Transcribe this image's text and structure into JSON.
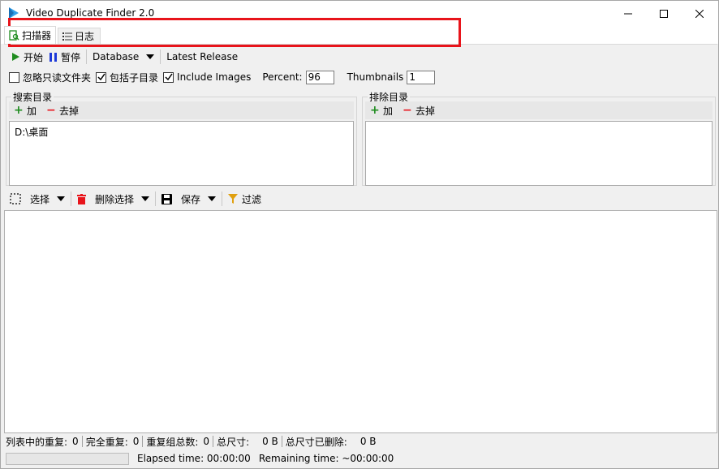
{
  "window": {
    "title": "Video Duplicate Finder 2.0"
  },
  "tabs": [
    {
      "label": "扫描器",
      "icon": "scanner-icon",
      "active": true
    },
    {
      "label": "日志",
      "icon": "list-icon",
      "active": false
    }
  ],
  "toolbar": {
    "start_label": "开始",
    "pause_label": "暂停",
    "database_label": "Database",
    "latest_release_label": "Latest Release"
  },
  "options": {
    "ignore_readonly_label": "忽略只读文件夹",
    "ignore_readonly_checked": false,
    "include_subdirs_label": "包括子目录",
    "include_subdirs_checked": true,
    "include_images_label": "Include Images",
    "include_images_checked": true,
    "percent_label": "Percent:",
    "percent_value": "96",
    "thumbnails_label": "Thumbnails",
    "thumbnails_value": "1"
  },
  "search_dirs": {
    "title": "搜索目录",
    "add_label": "加",
    "remove_label": "去掉",
    "items": [
      "D:\\桌面"
    ]
  },
  "exclude_dirs": {
    "title": "排除目录",
    "add_label": "加",
    "remove_label": "去掉",
    "items": []
  },
  "results_toolbar": {
    "select_label": "选择",
    "delete_selection_label": "删除选择",
    "save_label": "保存",
    "filter_label": "过滤"
  },
  "statusbar": {
    "dupes_in_list_label": "列表中的重复:",
    "dupes_in_list_value": "0",
    "full_dupes_label": "完全重复:",
    "full_dupes_value": "0",
    "dupe_groups_label": "重复组总数:",
    "dupe_groups_value": "0",
    "total_size_label": "总尺寸:",
    "total_size_value": "0 B",
    "total_size_removed_label": "总尺寸已删除:",
    "total_size_removed_value": "0 B"
  },
  "progress": {
    "value": 0,
    "elapsed_text": "Elapsed time: 00:00:00",
    "remaining_text": "Remaining time: ~00:00:00"
  },
  "colors": {
    "highlight": "#e8141b",
    "plus_green": "#1f8c1f",
    "minus_red": "#e8141b",
    "pause_blue": "#1c38d8",
    "filter_orange": "#e0a010"
  }
}
